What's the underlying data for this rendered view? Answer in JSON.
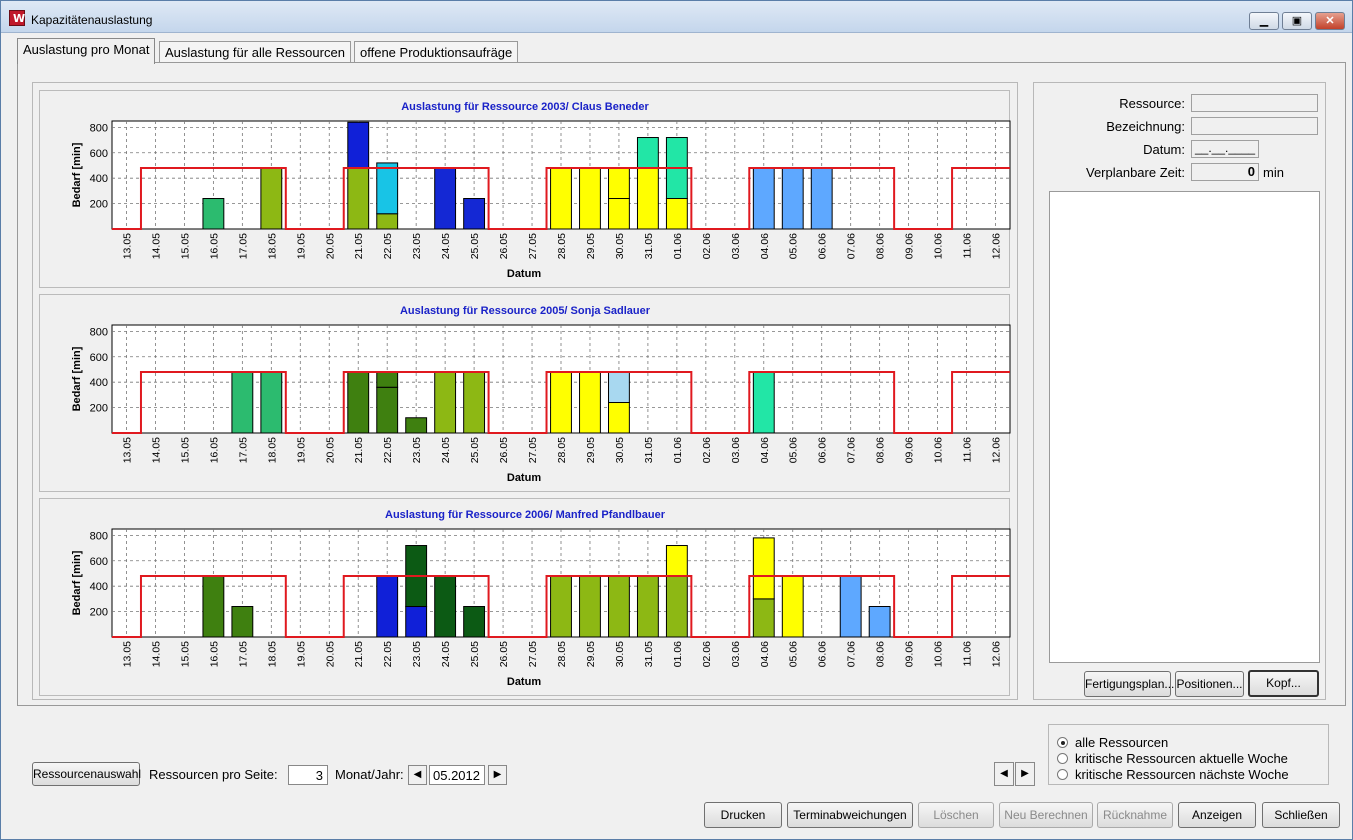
{
  "window": {
    "title": "Kapazitätenauslastung",
    "icon": "app-logo-icon"
  },
  "tabs": [
    {
      "label": "Auslastung pro Monat",
      "active": true
    },
    {
      "label": "Auslastung für alle Ressourcen",
      "active": false
    },
    {
      "label": "offene Produktionsaufräge",
      "active": false
    }
  ],
  "chart_common": {
    "ylabel": "Bedarf [min]",
    "xlabel": "Datum",
    "ylim": [
      0,
      850
    ],
    "yticks": [
      200,
      400,
      600,
      800
    ],
    "capacity_line_color": "#e0191f",
    "dates": [
      "13.05",
      "14.05",
      "15.05",
      "16.05",
      "17.05",
      "18.05",
      "19.05",
      "20.05",
      "21.05",
      "22.05",
      "23.05",
      "24.05",
      "25.05",
      "26.05",
      "27.05",
      "28.05",
      "29.05",
      "30.05",
      "31.05",
      "01.06",
      "02.06",
      "03.06",
      "04.06",
      "05.06",
      "06.06",
      "07.06",
      "08.06",
      "09.06",
      "10.06",
      "11.06",
      "12.06"
    ]
  },
  "chart_data": [
    {
      "type": "bar",
      "title": "Auslastung für Ressource 2003/ Claus Beneder",
      "capacity": [
        0,
        480,
        480,
        480,
        480,
        480,
        0,
        0,
        480,
        480,
        480,
        480,
        480,
        0,
        0,
        480,
        480,
        480,
        480,
        480,
        0,
        0,
        480,
        480,
        480,
        480,
        480,
        0,
        0,
        480,
        480
      ],
      "bars": [
        {
          "date": "16.05",
          "segments": [
            {
              "value": 240,
              "color": "#2cbb6f"
            }
          ]
        },
        {
          "date": "18.05",
          "segments": [
            {
              "value": 480,
              "color": "#8db814"
            }
          ]
        },
        {
          "date": "21.05",
          "segments": [
            {
              "value": 480,
              "color": "#8db814"
            },
            {
              "value": 360,
              "color": "#1020d8"
            }
          ]
        },
        {
          "date": "22.05",
          "segments": [
            {
              "value": 120,
              "color": "#8db814"
            },
            {
              "value": 400,
              "color": "#18c4e6"
            }
          ]
        },
        {
          "date": "24.05",
          "segments": [
            {
              "value": 480,
              "color": "#1428d4"
            }
          ]
        },
        {
          "date": "25.05",
          "segments": [
            {
              "value": 240,
              "color": "#1428d4"
            }
          ]
        },
        {
          "date": "28.05",
          "segments": [
            {
              "value": 480,
              "color": "#ffff00"
            }
          ]
        },
        {
          "date": "29.05",
          "segments": [
            {
              "value": 480,
              "color": "#ffff00"
            }
          ]
        },
        {
          "date": "30.05",
          "segments": [
            {
              "value": 240,
              "color": "#ffff00"
            },
            {
              "value": 240,
              "color": "#ffff00"
            }
          ]
        },
        {
          "date": "31.05",
          "segments": [
            {
              "value": 480,
              "color": "#ffff00"
            },
            {
              "value": 240,
              "color": "#22e6a6"
            }
          ]
        },
        {
          "date": "01.06",
          "segments": [
            {
              "value": 240,
              "color": "#ffff00"
            },
            {
              "value": 480,
              "color": "#22e6a6"
            }
          ]
        },
        {
          "date": "04.06",
          "segments": [
            {
              "value": 480,
              "color": "#5ea8ff"
            }
          ]
        },
        {
          "date": "05.06",
          "segments": [
            {
              "value": 480,
              "color": "#5ea8ff"
            }
          ]
        },
        {
          "date": "06.06",
          "segments": [
            {
              "value": 480,
              "color": "#5ea8ff"
            }
          ]
        }
      ]
    },
    {
      "type": "bar",
      "title": "Auslastung für Ressource 2005/ Sonja Sadlauer",
      "capacity": [
        0,
        480,
        480,
        480,
        480,
        480,
        0,
        0,
        480,
        480,
        480,
        480,
        480,
        0,
        0,
        480,
        480,
        480,
        480,
        480,
        0,
        0,
        480,
        480,
        480,
        480,
        480,
        0,
        0,
        480,
        480
      ],
      "bars": [
        {
          "date": "17.05",
          "segments": [
            {
              "value": 480,
              "color": "#2cbb6f"
            }
          ]
        },
        {
          "date": "18.05",
          "segments": [
            {
              "value": 480,
              "color": "#2cbb6f"
            }
          ]
        },
        {
          "date": "21.05",
          "segments": [
            {
              "value": 480,
              "color": "#3f8010"
            }
          ]
        },
        {
          "date": "22.05",
          "segments": [
            {
              "value": 360,
              "color": "#3f8010"
            },
            {
              "value": 120,
              "color": "#3f8010"
            }
          ]
        },
        {
          "date": "23.05",
          "segments": [
            {
              "value": 120,
              "color": "#3f8010"
            }
          ]
        },
        {
          "date": "24.05",
          "segments": [
            {
              "value": 480,
              "color": "#8db814"
            }
          ]
        },
        {
          "date": "25.05",
          "segments": [
            {
              "value": 480,
              "color": "#8db814"
            }
          ]
        },
        {
          "date": "28.05",
          "segments": [
            {
              "value": 480,
              "color": "#ffff00"
            }
          ]
        },
        {
          "date": "29.05",
          "segments": [
            {
              "value": 480,
              "color": "#ffff00"
            }
          ]
        },
        {
          "date": "30.05",
          "segments": [
            {
              "value": 240,
              "color": "#ffff00"
            },
            {
              "value": 240,
              "color": "#a8d8f0"
            }
          ]
        },
        {
          "date": "04.06",
          "segments": [
            {
              "value": 480,
              "color": "#22e6a6"
            }
          ]
        }
      ]
    },
    {
      "type": "bar",
      "title": "Auslastung für Ressource 2006/ Manfred Pfandlbauer",
      "capacity": [
        0,
        480,
        480,
        480,
        480,
        480,
        0,
        0,
        480,
        480,
        480,
        480,
        480,
        0,
        0,
        480,
        480,
        480,
        480,
        480,
        0,
        0,
        480,
        480,
        480,
        480,
        480,
        0,
        0,
        480,
        480
      ],
      "bars": [
        {
          "date": "16.05",
          "segments": [
            {
              "value": 480,
              "color": "#3f8010"
            }
          ]
        },
        {
          "date": "17.05",
          "segments": [
            {
              "value": 240,
              "color": "#3f8010"
            }
          ]
        },
        {
          "date": "22.05",
          "segments": [
            {
              "value": 480,
              "color": "#1020d8"
            }
          ]
        },
        {
          "date": "23.05",
          "segments": [
            {
              "value": 240,
              "color": "#1020d8"
            },
            {
              "value": 480,
              "color": "#0c5a14"
            }
          ]
        },
        {
          "date": "24.05",
          "segments": [
            {
              "value": 480,
              "color": "#0c5a14"
            }
          ]
        },
        {
          "date": "25.05",
          "segments": [
            {
              "value": 240,
              "color": "#0c5a14"
            }
          ]
        },
        {
          "date": "28.05",
          "segments": [
            {
              "value": 480,
              "color": "#8db814"
            }
          ]
        },
        {
          "date": "29.05",
          "segments": [
            {
              "value": 480,
              "color": "#8db814"
            }
          ]
        },
        {
          "date": "30.05",
          "segments": [
            {
              "value": 480,
              "color": "#8db814"
            }
          ]
        },
        {
          "date": "31.05",
          "segments": [
            {
              "value": 480,
              "color": "#8db814"
            }
          ]
        },
        {
          "date": "01.06",
          "segments": [
            {
              "value": 480,
              "color": "#8db814"
            },
            {
              "value": 240,
              "color": "#ffff00"
            }
          ]
        },
        {
          "date": "04.06",
          "segments": [
            {
              "value": 300,
              "color": "#8db814"
            },
            {
              "value": 480,
              "color": "#ffff00"
            }
          ]
        },
        {
          "date": "05.06",
          "segments": [
            {
              "value": 480,
              "color": "#ffff00"
            }
          ]
        },
        {
          "date": "07.06",
          "segments": [
            {
              "value": 480,
              "color": "#5ea8ff"
            }
          ]
        },
        {
          "date": "08.06",
          "segments": [
            {
              "value": 240,
              "color": "#5ea8ff"
            }
          ]
        }
      ]
    }
  ],
  "details": {
    "ressource_label": "Ressource:",
    "ressource_value": "",
    "bezeichnung_label": "Bezeichnung:",
    "bezeichnung_value": "",
    "datum_label": "Datum:",
    "datum_value": "__.__.____",
    "zeit_label": "Verplanbare Zeit:",
    "zeit_value": "0",
    "zeit_unit": "min",
    "fertigungsplan_button": "Fertigungsplan...",
    "positionen_button": "Positionen...",
    "kopf_button": "Kopf..."
  },
  "filter": {
    "options": [
      {
        "label": "alle Ressourcen",
        "selected": true
      },
      {
        "label": "kritische Ressourcen aktuelle Woche",
        "selected": false
      },
      {
        "label": "kritische Ressourcen nächste Woche",
        "selected": false
      }
    ]
  },
  "controls": {
    "ressourcenauswahl_button": "Ressourcenauswahl",
    "per_page_label": "Ressourcen pro Seite:",
    "per_page_value": "3",
    "month_label": "Monat/Jahr:",
    "month_value": "05.2012"
  },
  "footer": {
    "drucken": "Drucken",
    "terminabweichungen": "Terminabweichungen",
    "loeschen": "Löschen",
    "neu_berechnen": "Neu Berechnen",
    "ruecknahme": "Rücknahme",
    "anzeigen": "Anzeigen",
    "schliessen": "Schließen"
  }
}
